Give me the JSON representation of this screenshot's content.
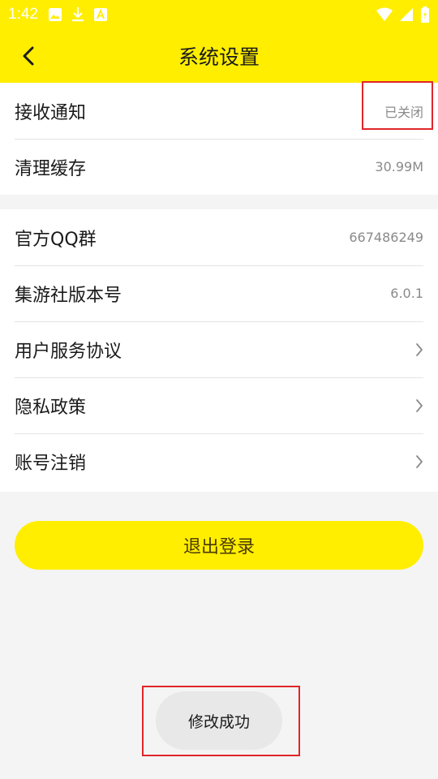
{
  "status_bar": {
    "time": "1:42",
    "left_icons": [
      "image-icon",
      "download-icon",
      "app-notification-icon"
    ],
    "right_icons": [
      "wifi-icon",
      "signal-icon",
      "battery-charging-icon"
    ]
  },
  "app_bar": {
    "title": "系统设置",
    "back_icon": "chevron-left-icon"
  },
  "settings_group_1": [
    {
      "label": "接收通知",
      "value": "已关闭"
    },
    {
      "label": "清理缓存",
      "value": "30.99M"
    }
  ],
  "settings_group_2": [
    {
      "label": "官方QQ群",
      "value": "667486249"
    },
    {
      "label": "集游社版本号",
      "value": "6.0.1"
    },
    {
      "label": "用户服务协议",
      "chevron": "chevron-right-icon"
    },
    {
      "label": "隐私政策",
      "chevron": "chevron-right-icon"
    },
    {
      "label": "账号注销",
      "chevron": "chevron-right-icon"
    }
  ],
  "logout_button": {
    "label": "退出登录"
  },
  "toast": {
    "message": "修改成功"
  },
  "colors": {
    "accent_yellow": "#ffee00",
    "highlight_red": "#e0262a",
    "background": "#f4f4f4"
  }
}
